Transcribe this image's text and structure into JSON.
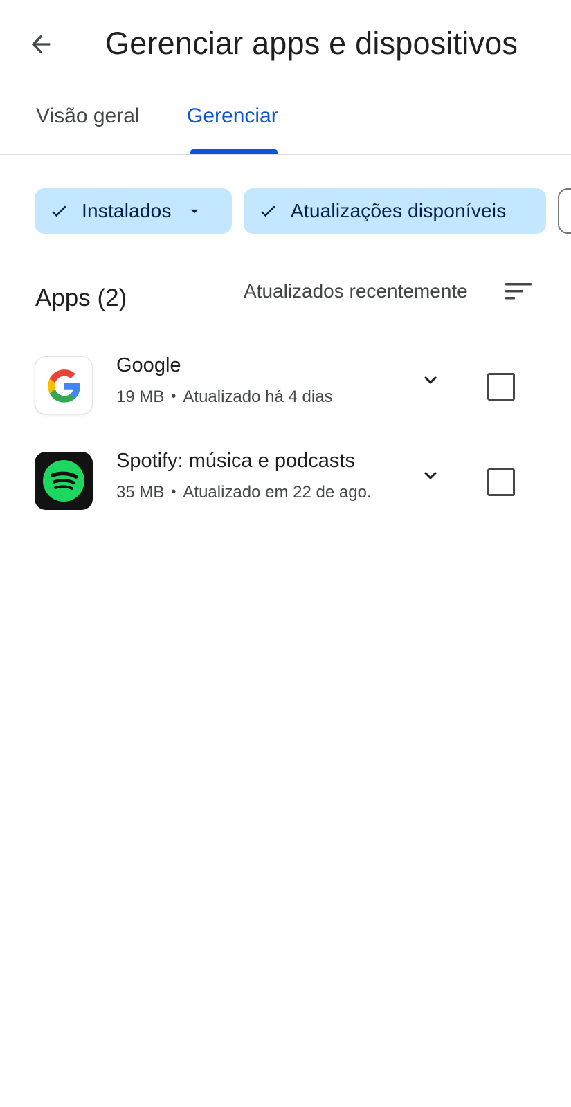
{
  "header": {
    "title": "Gerenciar apps e dispositivos",
    "back_icon": "arrow-left-icon"
  },
  "tabs": [
    {
      "label": "Visão geral",
      "selected": false
    },
    {
      "label": "Gerenciar",
      "selected": true
    }
  ],
  "filters": [
    {
      "label": "Instalados",
      "selected": true,
      "has_dropdown": true
    },
    {
      "label": "Atualizações disponíveis",
      "selected": true,
      "has_dropdown": false
    }
  ],
  "section": {
    "title": "Apps (2)",
    "sort_label": "Atualizados recentemente",
    "sort_icon": "sort-icon"
  },
  "apps": [
    {
      "name": "Google",
      "size": "19 MB",
      "separator": "•",
      "updated": "Atualizado há 4 dias",
      "icon": "google-logo-icon",
      "checked": false
    },
    {
      "name": "Spotify: música e podcasts",
      "size": "35 MB",
      "separator": "•",
      "updated": "Atualizado em 22 de ago.",
      "icon": "spotify-logo-icon",
      "checked": false
    }
  ],
  "colors": {
    "accent": "#0b57d0",
    "chip_background": "#c2e7ff",
    "chip_text": "#041e49",
    "spotify_green": "#1ed760",
    "text_primary": "#1f1f1f",
    "text_secondary": "#444746"
  }
}
